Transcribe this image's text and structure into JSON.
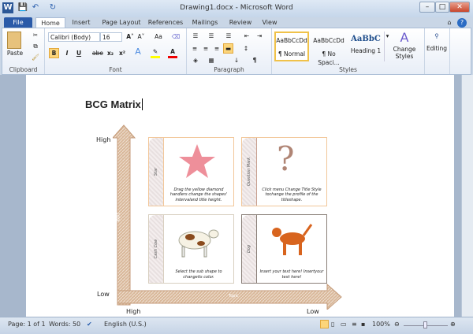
{
  "window": {
    "title": "Drawing1.docx - Microsoft Word"
  },
  "quick_access": {
    "save": "💾",
    "undo": "↶",
    "redo": "↻"
  },
  "tabs": [
    "File",
    "Home",
    "Insert",
    "Page Layout",
    "References",
    "Mailings",
    "Review",
    "View"
  ],
  "ribbon": {
    "clipboard": {
      "label": "Clipboard",
      "paste": "Paste"
    },
    "font": {
      "label": "Font",
      "font_name": "Calibri (Body)",
      "font_size": "16",
      "bold": "B",
      "italic": "I",
      "underline": "U",
      "strike": "abe",
      "sub": "x₂",
      "sup": "x²",
      "grow": "A˄",
      "shrink": "A˅",
      "case": "Aa"
    },
    "paragraph": {
      "label": "Paragraph",
      "pilcrow": "¶"
    },
    "styles": {
      "label": "Styles",
      "items": [
        {
          "preview": "AaBbCcDd",
          "name": "¶ Normal"
        },
        {
          "preview": "AaBbCcDd",
          "name": "¶ No Spaci..."
        },
        {
          "preview": "AaBbC",
          "name": "Heading 1"
        }
      ],
      "change_styles": "Change Styles"
    },
    "editing": {
      "label": "Editing"
    }
  },
  "document": {
    "heading": "BCG Matrix",
    "axis": {
      "y_high": "High",
      "y_low": "Low",
      "x_high": "High",
      "x_low": "Low",
      "y_topic": "Topic",
      "x_topic": "Topic"
    },
    "quadrants": [
      {
        "title": "Star",
        "text": "Drag the yellow diamond handlers change the shapes' intervaland title height."
      },
      {
        "title": "Question Mark",
        "text": "Click menu Change Title Style tochange the profile of the titleshape."
      },
      {
        "title": "Cash Cow",
        "text": "Select the sub shape to changeits color."
      },
      {
        "title": "Dog",
        "text": "Insert your text here! Insertyour text here!"
      }
    ]
  },
  "status": {
    "page": "Page: 1 of 1",
    "words": "Words: 50",
    "language": "English (U.S.)",
    "zoom": "100%"
  }
}
